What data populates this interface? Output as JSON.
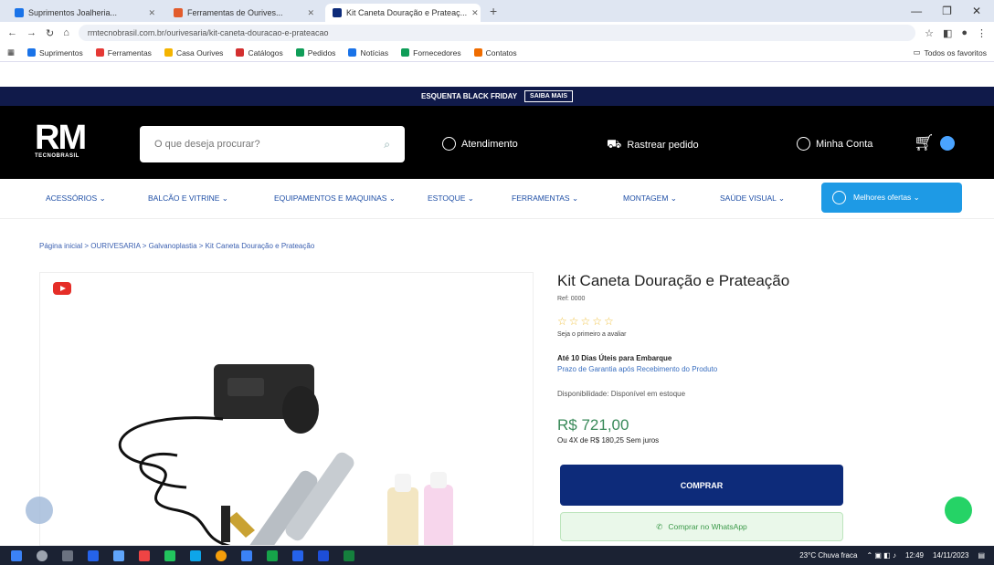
{
  "browser": {
    "tabs": [
      {
        "label": "Suprimentos Joalheria...",
        "favicon": "#1a73e8",
        "active": false
      },
      {
        "label": "Ferramentas de Ourives...",
        "favicon": "#e25b2b",
        "active": false
      },
      {
        "label": "Kit Caneta Douração e Prateaç...",
        "favicon": "#0d2b7a",
        "active": true
      }
    ],
    "new_tab": "+",
    "url": "rmtecnobrasil.com.br/ourivesaria/kit-caneta-douracao-e-prateacao",
    "bookmarks": [
      {
        "label": "Suprimentos",
        "color": "#1a73e8"
      },
      {
        "label": "Ferramentas",
        "color": "#e53935"
      },
      {
        "label": "Casa Ourives",
        "color": "#f4b400"
      },
      {
        "label": "Catálogos",
        "color": "#d32f2f"
      },
      {
        "label": "Pedidos",
        "color": "#0f9d58"
      },
      {
        "label": "Notícias",
        "color": "#1a73e8"
      },
      {
        "label": "Fornecedores",
        "color": "#0f9d58"
      },
      {
        "label": "Contatos",
        "color": "#ef6c00"
      }
    ],
    "all_bookmarks": "Todos os favoritos"
  },
  "site": {
    "promo_text": "ESQUENTA BLACK FRIDAY",
    "promo_button": "SAIBA MAIS",
    "logo_big": "RM",
    "logo_small": "TECNOBRASIL",
    "search_placeholder": "O que deseja procurar?",
    "header_links": [
      {
        "label": "Atendimento"
      },
      {
        "label": "Rastrear pedido"
      },
      {
        "label": "Minha Conta"
      }
    ],
    "nav": [
      "ACESSÓRIOS ⌄",
      "BALCÃO E VITRINE ⌄",
      "EQUIPAMENTOS E MAQUINAS ⌄",
      "ESTOQUE ⌄",
      "FERRAMENTAS ⌄",
      "MONTAGEM ⌄",
      "SAÚDE VISUAL ⌄"
    ],
    "nav_special": "Melhores ofertas ⌄",
    "breadcrumb": "Página inicial > OURIVESARIA > Galvanoplastia > Kit Caneta Douração e Prateação"
  },
  "product": {
    "title": "Kit Caneta Douração e Prateação",
    "sku": "Ref: 0000",
    "rating": "☆☆☆☆☆",
    "review_cta": "Seja o primeiro a avaliar",
    "shipping_title": "Até 10 Dias Úteis para Embarque",
    "shipping_sub": "Prazo de Garantia após Recebimento do Produto",
    "availability": "Disponibilidade: Disponível em estoque",
    "price": "R$ 721,00",
    "installments": "Ou 4X de R$ 180,25 Sem juros",
    "buy_button": "COMPRAR",
    "whatsapp_button": "Comprar no WhatsApp"
  },
  "taskbar": {
    "weather": "23°C Chuva fraca",
    "time": "12:49",
    "date": "14/11/2023"
  }
}
